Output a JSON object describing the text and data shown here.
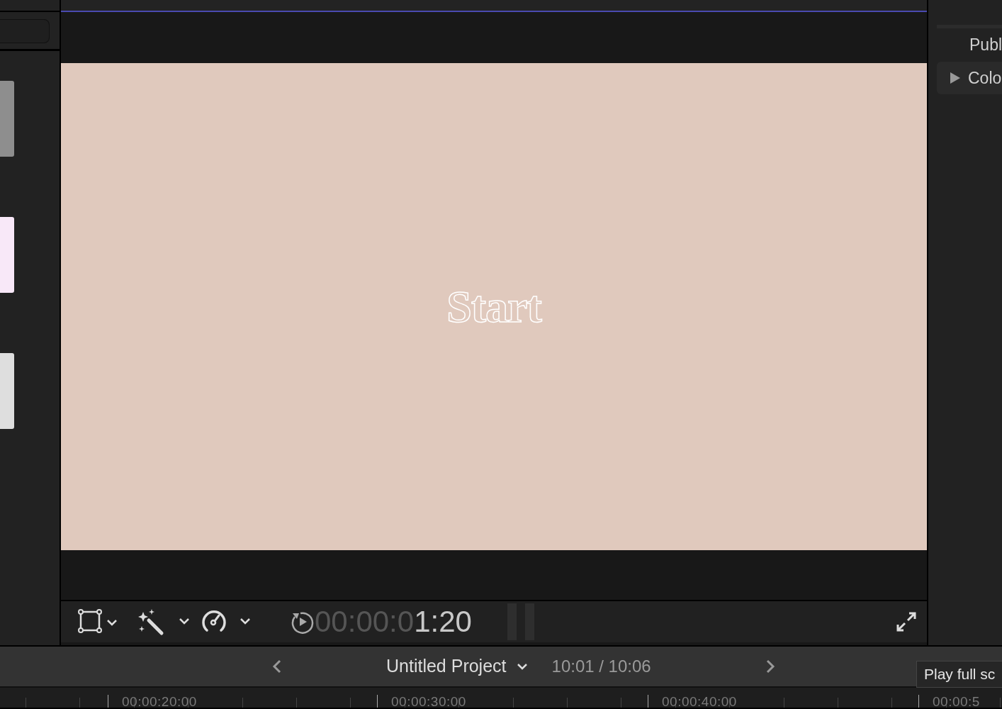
{
  "browser": {
    "clips": [
      {
        "color": "#8e8e8e"
      },
      {
        "color": "#f8e8f8"
      },
      {
        "color": "#dedede"
      }
    ]
  },
  "viewer": {
    "frame_text": "Start",
    "timecode_dim": "00:00:0",
    "timecode_bright": "1:20"
  },
  "inspector": {
    "heading": "Publ",
    "sections": [
      {
        "label": "Colo",
        "expanded": false
      }
    ]
  },
  "project_bar": {
    "name": "Untitled Project",
    "duration": "10:01 / 10:06"
  },
  "tooltip": "Play full sc",
  "ruler": [
    "00:00:20:00",
    "00:00:30:00",
    "00:00:40:00",
    "00:00:5"
  ]
}
